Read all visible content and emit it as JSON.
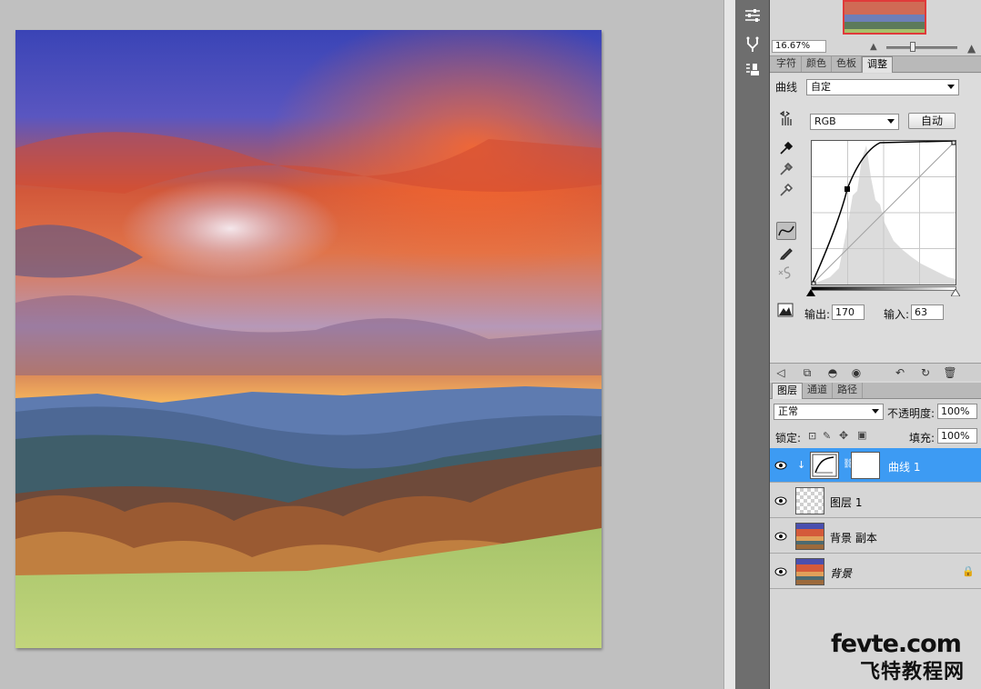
{
  "navigator": {
    "zoom": "16.67%"
  },
  "adjust_tabs": [
    "字符",
    "颜色",
    "色板",
    "调整"
  ],
  "curves": {
    "title": "曲线",
    "preset": "自定",
    "channel": "RGB",
    "auto_label": "自动",
    "output_label": "输出:",
    "output_value": "170",
    "input_label": "输入:",
    "input_value": "63"
  },
  "layer_tabs": [
    "图层",
    "通道",
    "路径"
  ],
  "layers_panel": {
    "blend_mode": "正常",
    "opacity_label": "不透明度:",
    "opacity_value": "100%",
    "lock_label": "锁定:",
    "fill_label": "填充:",
    "fill_value": "100%"
  },
  "layers": [
    {
      "name": "曲线 1",
      "selected": true
    },
    {
      "name": "图层 1",
      "selected": false
    },
    {
      "name": "背景 副本",
      "selected": false
    },
    {
      "name": "背景",
      "selected": false
    }
  ],
  "watermark": {
    "line1": "fevte.com",
    "line2": "飞特教程网"
  }
}
